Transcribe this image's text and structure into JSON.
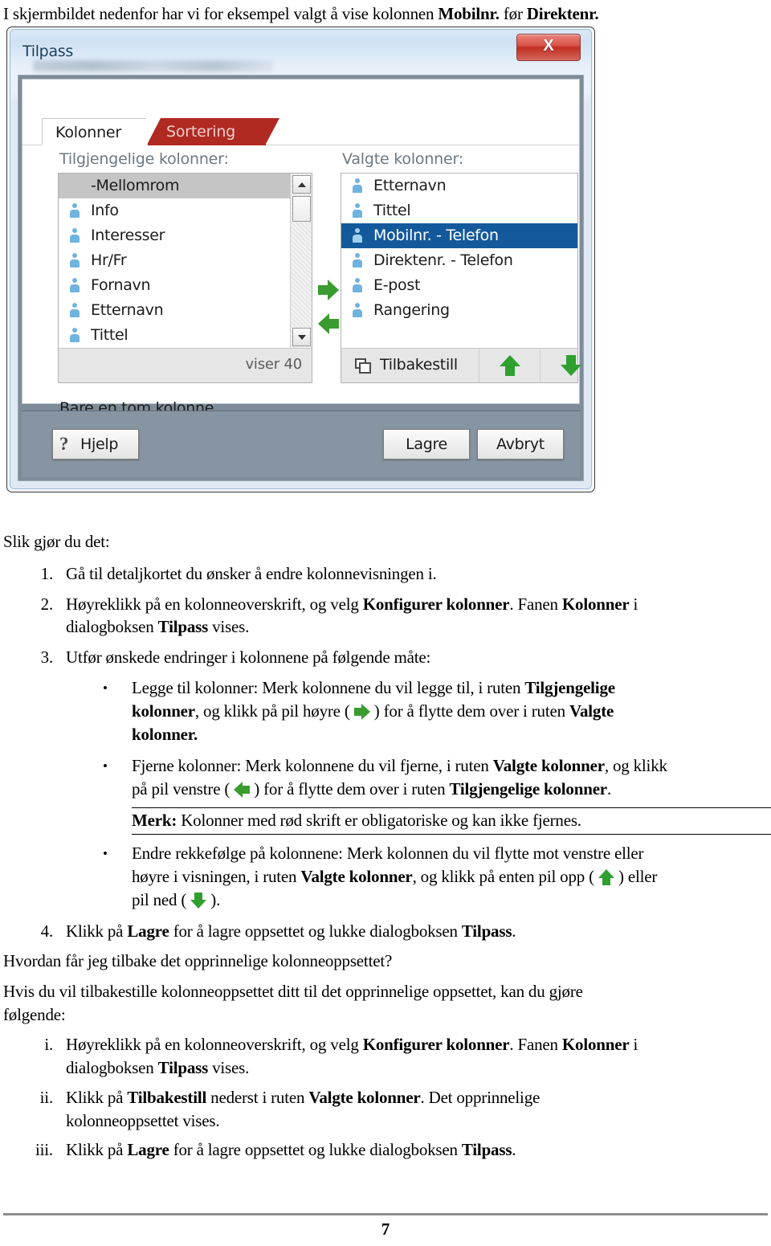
{
  "intro": {
    "before": "I skjermbildet nedenfor har vi for eksempel valgt å vise kolonnen ",
    "bold1": "Mobilnr.",
    "middle": " før ",
    "bold2": "Direktenr."
  },
  "dialog": {
    "title": "Tilpass",
    "close_label": "X",
    "accent_tab_color": "#b02a22",
    "selection_color": "#14599c",
    "tabs": [
      {
        "label": "Kolonner",
        "active": true
      },
      {
        "label": "Sortering",
        "active": false
      }
    ],
    "available": {
      "label": "Tilgjengelige kolonner:",
      "items": [
        {
          "label": "-Mellomrom",
          "selected": true,
          "icon": "person-icon",
          "show_icon": false
        },
        {
          "label": "Info",
          "selected": false,
          "icon": "person-icon",
          "show_icon": true
        },
        {
          "label": "Interesser",
          "selected": false,
          "icon": "person-icon",
          "show_icon": true
        },
        {
          "label": "Hr/Fr",
          "selected": false,
          "icon": "person-icon",
          "show_icon": true
        },
        {
          "label": "Fornavn",
          "selected": false,
          "icon": "person-icon",
          "show_icon": true
        },
        {
          "label": "Etternavn",
          "selected": false,
          "icon": "person-icon",
          "show_icon": true
        },
        {
          "label": "Tittel",
          "selected": false,
          "icon": "person-icon",
          "show_icon": true
        }
      ],
      "footer_count": "viser  40"
    },
    "selected": {
      "label": "Valgte kolonner:",
      "items": [
        {
          "label": "Etternavn",
          "selected": false,
          "icon": "person-icon"
        },
        {
          "label": "Tittel",
          "selected": false,
          "icon": "person-icon"
        },
        {
          "label": "Mobilnr. - Telefon",
          "selected": true,
          "icon": "person-icon"
        },
        {
          "label": "Direktenr. - Telefon",
          "selected": false,
          "icon": "person-icon"
        },
        {
          "label": "E-post",
          "selected": false,
          "icon": "person-icon"
        },
        {
          "label": "Rangering",
          "selected": false,
          "icon": "person-icon"
        }
      ],
      "reset_label": "Tilbakestill",
      "move_up_icon": "arrow-up-icon",
      "move_down_icon": "arrow-down-icon"
    },
    "move_right_icon": "arrow-right-icon",
    "move_left_icon": "arrow-left-icon",
    "hint": "Bare en tom kolonne.",
    "buttons": {
      "help": "Hjelp",
      "save": "Lagre",
      "cancel": "Avbryt"
    }
  },
  "doc": {
    "heading": "Slik gjør du det:",
    "step1_num": "1.",
    "step1": "Gå til detaljkortet du ønsker å endre kolonnevisningen i.",
    "step2_num": "2.",
    "step2_a": "Høyreklikk på en kolonneoverskrift, og velg ",
    "step2_b1": "Konfigurer kolonner",
    "step2_c": ". Fanen ",
    "step2_b2": "Kolonner",
    "step2_d": " i",
    "step2_line2_a": "dialogboksen ",
    "step2_line2_b": "Tilpass",
    "step2_line2_c": " vises.",
    "step3_num": "3.",
    "step3": "Utfør ønskede endringer i kolonnene på følgende måte:",
    "b1_l1_a": "Legge til kolonner: Merk kolonnene du vil legge til, i ruten ",
    "b1_l1_b": "Tilgjengelige",
    "b1_l2_b": "kolonner",
    "b1_l2_a": ", og klikk på pil høyre ( ",
    "b1_l2_c": " ) for å flytte dem over i ruten ",
    "b1_l2_d": "Valgte",
    "b1_l3": "kolonner.",
    "b2_l1_a": "Fjerne kolonner: Merk kolonnene du vil fjerne, i ruten ",
    "b2_l1_b": "Valgte kolonner",
    "b2_l1_c": ", og klikk",
    "b2_l2_a": "på pil venstre ( ",
    "b2_l2_b": " ) for å flytte dem over i ruten ",
    "b2_l2_c": "Tilgjengelige kolonner",
    "b2_l2_d": ".",
    "merk_b": "Merk:",
    "merk_t": " Kolonner med rød skrift er obligatoriske og kan ikke fjernes.",
    "b3_l1": "Endre rekkefølge på kolonnene: Merk kolonnen du vil flytte mot venstre eller",
    "b3_l2_a": "høyre i visningen, i ruten ",
    "b3_l2_b": "Valgte kolonner",
    "b3_l2_c": ", og klikk på enten pil opp ( ",
    "b3_l2_d": " ) eller",
    "b3_l3_a": "pil ned ( ",
    "b3_l3_b": " ).",
    "step4_num": "4.",
    "step4_a": "Klikk på ",
    "step4_b1": "Lagre",
    "step4_c": " for å lagre oppsettet og lukke dialogboksen ",
    "step4_b2": "Tilpass",
    "step4_d": ".",
    "q_heading": "Hvordan får jeg tilbake det opprinnelige kolonneoppsettet?",
    "q_body_l1": "Hvis du vil tilbakestille kolonneoppsettet ditt til det opprinnelige oppsettet, kan du gjøre",
    "q_body_l2": "følgende:",
    "i_num": "i.",
    "i_l1_a": "Høyreklikk på en kolonneoverskrift, og velg ",
    "i_l1_b1": "Konfigurer kolonner",
    "i_l1_c": ". Fanen ",
    "i_l1_b2": "Kolonner",
    "i_l1_d": " i",
    "i_l2_a": "dialogboksen ",
    "i_l2_b": "Tilpass",
    "i_l2_c": " vises.",
    "ii_num": "ii.",
    "ii_l1_a": "Klikk på ",
    "ii_l1_b1": "Tilbakestill",
    "ii_l1_c": " nederst i ruten ",
    "ii_l1_b2": "Valgte kolonner",
    "ii_l1_d": ". Det opprinnelige",
    "ii_l2": "kolonneoppsettet vises.",
    "iii_num": "iii.",
    "iii_l1_a": "Klikk på ",
    "iii_l1_b1": "Lagre",
    "iii_l1_c": " for å lagre oppsettet og lukke dialogboksen ",
    "iii_l1_b2": "Tilpass",
    "iii_l1_d": ".",
    "page_number": "7"
  }
}
